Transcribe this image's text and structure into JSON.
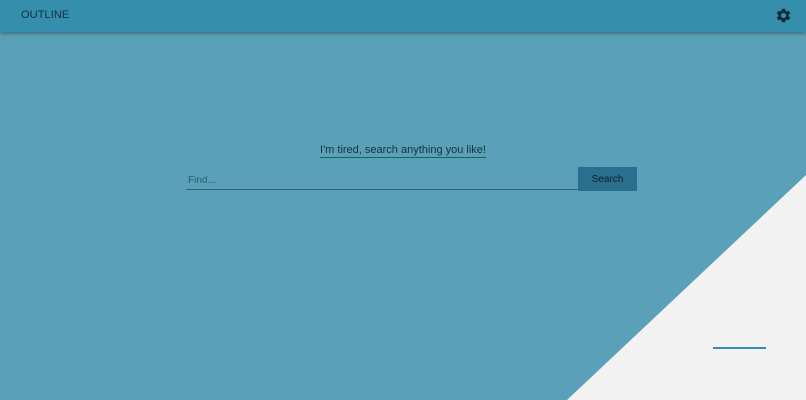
{
  "header": {
    "brand": "OUTLINE",
    "settings_icon": "gear-icon"
  },
  "main": {
    "tagline": "I'm tired, search anything you like!",
    "search": {
      "placeholder": "Find...",
      "value": "",
      "button_label": "Search"
    }
  },
  "colors": {
    "background": "#5aa0b8",
    "topbar": "#358eab",
    "corner_fill": "#f2f2f2",
    "button": "#2b6f8f",
    "accent_underline": "#0d6b55"
  }
}
